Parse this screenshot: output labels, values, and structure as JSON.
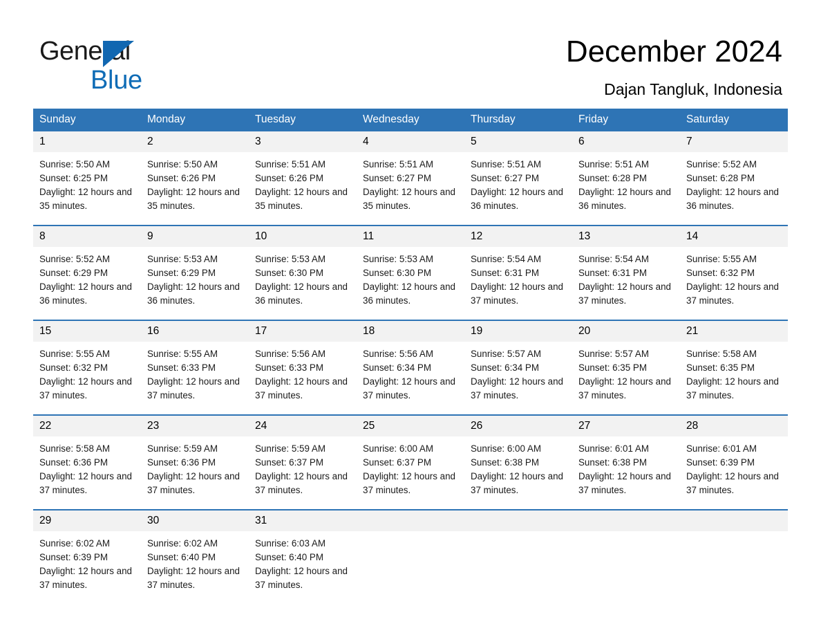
{
  "brand": {
    "name_part1": "General",
    "name_part2": "Blue",
    "triangle_color": "#1167b1",
    "blue_color": "#0f6cb6"
  },
  "header": {
    "title": "December 2024",
    "subtitle": "Dajan Tangluk, Indonesia"
  },
  "theme": {
    "header_blue": "#2e74b5",
    "daynum_gray": "#f2f2f2",
    "text_black": "#000000"
  },
  "weekdays": [
    "Sunday",
    "Monday",
    "Tuesday",
    "Wednesday",
    "Thursday",
    "Friday",
    "Saturday"
  ],
  "weeks": [
    [
      {
        "day": "1",
        "info": "Sunrise: 5:50 AM\nSunset: 6:25 PM\nDaylight: 12 hours and 35 minutes."
      },
      {
        "day": "2",
        "info": "Sunrise: 5:50 AM\nSunset: 6:26 PM\nDaylight: 12 hours and 35 minutes."
      },
      {
        "day": "3",
        "info": "Sunrise: 5:51 AM\nSunset: 6:26 PM\nDaylight: 12 hours and 35 minutes."
      },
      {
        "day": "4",
        "info": "Sunrise: 5:51 AM\nSunset: 6:27 PM\nDaylight: 12 hours and 35 minutes."
      },
      {
        "day": "5",
        "info": "Sunrise: 5:51 AM\nSunset: 6:27 PM\nDaylight: 12 hours and 36 minutes."
      },
      {
        "day": "6",
        "info": "Sunrise: 5:51 AM\nSunset: 6:28 PM\nDaylight: 12 hours and 36 minutes."
      },
      {
        "day": "7",
        "info": "Sunrise: 5:52 AM\nSunset: 6:28 PM\nDaylight: 12 hours and 36 minutes."
      }
    ],
    [
      {
        "day": "8",
        "info": "Sunrise: 5:52 AM\nSunset: 6:29 PM\nDaylight: 12 hours and 36 minutes."
      },
      {
        "day": "9",
        "info": "Sunrise: 5:53 AM\nSunset: 6:29 PM\nDaylight: 12 hours and 36 minutes."
      },
      {
        "day": "10",
        "info": "Sunrise: 5:53 AM\nSunset: 6:30 PM\nDaylight: 12 hours and 36 minutes."
      },
      {
        "day": "11",
        "info": "Sunrise: 5:53 AM\nSunset: 6:30 PM\nDaylight: 12 hours and 36 minutes."
      },
      {
        "day": "12",
        "info": "Sunrise: 5:54 AM\nSunset: 6:31 PM\nDaylight: 12 hours and 37 minutes."
      },
      {
        "day": "13",
        "info": "Sunrise: 5:54 AM\nSunset: 6:31 PM\nDaylight: 12 hours and 37 minutes."
      },
      {
        "day": "14",
        "info": "Sunrise: 5:55 AM\nSunset: 6:32 PM\nDaylight: 12 hours and 37 minutes."
      }
    ],
    [
      {
        "day": "15",
        "info": "Sunrise: 5:55 AM\nSunset: 6:32 PM\nDaylight: 12 hours and 37 minutes."
      },
      {
        "day": "16",
        "info": "Sunrise: 5:55 AM\nSunset: 6:33 PM\nDaylight: 12 hours and 37 minutes."
      },
      {
        "day": "17",
        "info": "Sunrise: 5:56 AM\nSunset: 6:33 PM\nDaylight: 12 hours and 37 minutes."
      },
      {
        "day": "18",
        "info": "Sunrise: 5:56 AM\nSunset: 6:34 PM\nDaylight: 12 hours and 37 minutes."
      },
      {
        "day": "19",
        "info": "Sunrise: 5:57 AM\nSunset: 6:34 PM\nDaylight: 12 hours and 37 minutes."
      },
      {
        "day": "20",
        "info": "Sunrise: 5:57 AM\nSunset: 6:35 PM\nDaylight: 12 hours and 37 minutes."
      },
      {
        "day": "21",
        "info": "Sunrise: 5:58 AM\nSunset: 6:35 PM\nDaylight: 12 hours and 37 minutes."
      }
    ],
    [
      {
        "day": "22",
        "info": "Sunrise: 5:58 AM\nSunset: 6:36 PM\nDaylight: 12 hours and 37 minutes."
      },
      {
        "day": "23",
        "info": "Sunrise: 5:59 AM\nSunset: 6:36 PM\nDaylight: 12 hours and 37 minutes."
      },
      {
        "day": "24",
        "info": "Sunrise: 5:59 AM\nSunset: 6:37 PM\nDaylight: 12 hours and 37 minutes."
      },
      {
        "day": "25",
        "info": "Sunrise: 6:00 AM\nSunset: 6:37 PM\nDaylight: 12 hours and 37 minutes."
      },
      {
        "day": "26",
        "info": "Sunrise: 6:00 AM\nSunset: 6:38 PM\nDaylight: 12 hours and 37 minutes."
      },
      {
        "day": "27",
        "info": "Sunrise: 6:01 AM\nSunset: 6:38 PM\nDaylight: 12 hours and 37 minutes."
      },
      {
        "day": "28",
        "info": "Sunrise: 6:01 AM\nSunset: 6:39 PM\nDaylight: 12 hours and 37 minutes."
      }
    ],
    [
      {
        "day": "29",
        "info": "Sunrise: 6:02 AM\nSunset: 6:39 PM\nDaylight: 12 hours and 37 minutes."
      },
      {
        "day": "30",
        "info": "Sunrise: 6:02 AM\nSunset: 6:40 PM\nDaylight: 12 hours and 37 minutes."
      },
      {
        "day": "31",
        "info": "Sunrise: 6:03 AM\nSunset: 6:40 PM\nDaylight: 12 hours and 37 minutes."
      },
      {
        "day": "",
        "info": ""
      },
      {
        "day": "",
        "info": ""
      },
      {
        "day": "",
        "info": ""
      },
      {
        "day": "",
        "info": ""
      }
    ]
  ]
}
